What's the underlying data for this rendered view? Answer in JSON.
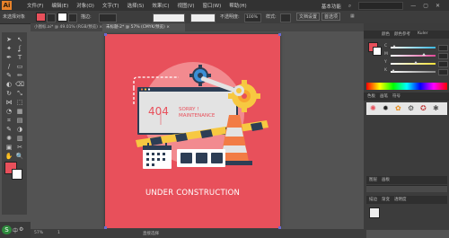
{
  "app": {
    "logo": "Ai"
  },
  "menubar": {
    "menus": [
      "文件(F)",
      "编辑(E)",
      "对象(O)",
      "文字(T)",
      "选择(S)",
      "效果(C)",
      "视图(V)",
      "窗口(W)",
      "帮助(H)"
    ],
    "workspace": "基本功能",
    "icons": [
      "bridge-icon",
      "grid-icon",
      "minimize-icon",
      "maximize-icon",
      "close-icon"
    ]
  },
  "control": {
    "selection_label": "未选择对象",
    "stroke_label": "描边:",
    "opacity_label": "不透明度:",
    "opacity_value": "100%",
    "style_label": "样式:",
    "doc_settings_button": "文档设置",
    "preferences_button": "首选项",
    "fill_color": "#e8505b",
    "stroke_color": "#ffffff"
  },
  "tabs": [
    {
      "label": "小图标.ai* @ 49.01% (RGB/预览)",
      "active": false
    },
    {
      "label": "未标题-2* @ 57% (CMYK/预览)",
      "active": true
    }
  ],
  "artwork": {
    "error_code": "404",
    "error_text_line1": "SORRY !",
    "error_text_line2": "MAINTENANCE",
    "caption": "UNDER CONSTRUCTION",
    "bg_color": "#e8505b",
    "circle_color": "#f28a8f",
    "accent_orange": "#f27c45",
    "accent_yellow": "#f7c841",
    "navy": "#2d3e55"
  },
  "status": {
    "zoom": "57%",
    "page": "1",
    "mode": "直接选择"
  },
  "panels": {
    "color_tabs": [
      "颜色",
      "颜色参考",
      "Kuler"
    ],
    "swatch_tabs": [
      "色板",
      "画笔",
      "符号"
    ],
    "layer_tabs": [
      "图层",
      "画板"
    ],
    "bottom_tabs": [
      "描边",
      "渐变",
      "透明度"
    ],
    "slider_labels": [
      "C",
      "M",
      "Y",
      "K"
    ],
    "slider_colors": [
      "#3bb8e0",
      "#e04898",
      "#f2e03a",
      "#888888"
    ],
    "slider_values": [
      0.05,
      0.72,
      0.55,
      0.02
    ]
  },
  "bottombar": {
    "ime": "S",
    "ime_label": "中"
  }
}
